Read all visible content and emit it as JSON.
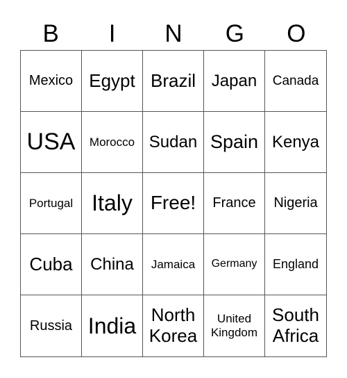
{
  "header": [
    "B",
    "I",
    "N",
    "G",
    "O"
  ],
  "cells": [
    {
      "text": "Mexico",
      "size": 20
    },
    {
      "text": "Egypt",
      "size": 26
    },
    {
      "text": "Brazil",
      "size": 26
    },
    {
      "text": "Japan",
      "size": 24
    },
    {
      "text": "Canada",
      "size": 19
    },
    {
      "text": "USA",
      "size": 34
    },
    {
      "text": "Morocco",
      "size": 17
    },
    {
      "text": "Sudan",
      "size": 24
    },
    {
      "text": "Spain",
      "size": 27
    },
    {
      "text": "Kenya",
      "size": 24
    },
    {
      "text": "Portugal",
      "size": 17
    },
    {
      "text": "Italy",
      "size": 32
    },
    {
      "text": "Free!",
      "size": 28
    },
    {
      "text": "France",
      "size": 20
    },
    {
      "text": "Nigeria",
      "size": 20
    },
    {
      "text": "Cuba",
      "size": 26
    },
    {
      "text": "China",
      "size": 24
    },
    {
      "text": "Jamaica",
      "size": 17
    },
    {
      "text": "Germany",
      "size": 16
    },
    {
      "text": "England",
      "size": 18
    },
    {
      "text": "Russia",
      "size": 20
    },
    {
      "text": "India",
      "size": 32
    },
    {
      "text": "North Korea",
      "size": 26
    },
    {
      "text": "United Kingdom",
      "size": 17
    },
    {
      "text": "South Africa",
      "size": 26
    }
  ]
}
